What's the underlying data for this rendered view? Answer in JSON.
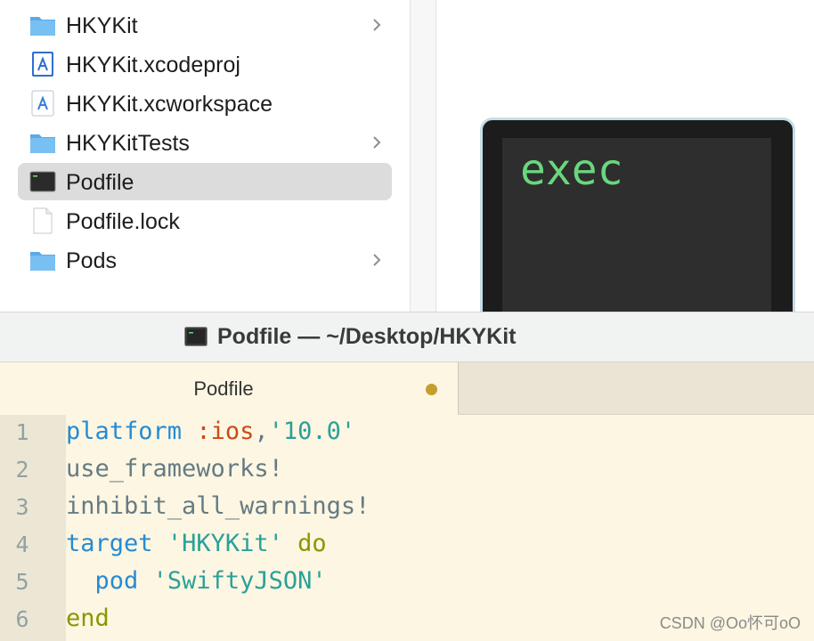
{
  "finder": {
    "files": [
      {
        "name": "HKYKit",
        "icon": "folder-icon",
        "has_children": true,
        "selected": false
      },
      {
        "name": "HKYKit.xcodeproj",
        "icon": "xcodeproj-icon",
        "has_children": false,
        "selected": false
      },
      {
        "name": "HKYKit.xcworkspace",
        "icon": "xcworkspace-icon",
        "has_children": false,
        "selected": false
      },
      {
        "name": "HKYKitTests",
        "icon": "folder-icon",
        "has_children": true,
        "selected": false
      },
      {
        "name": "Podfile",
        "icon": "terminal-file-icon",
        "has_children": false,
        "selected": true
      },
      {
        "name": "Podfile.lock",
        "icon": "document-icon",
        "has_children": false,
        "selected": false
      },
      {
        "name": "Pods",
        "icon": "folder-icon",
        "has_children": true,
        "selected": false
      }
    ],
    "preview": {
      "icon_text": "exec",
      "icon": "terminal-exec-icon"
    }
  },
  "editor": {
    "window_title": "Podfile — ~/Desktop/HKYKit",
    "tab_label": "Podfile",
    "unsaved": true,
    "code_lines": [
      {
        "num": "1",
        "tokens": [
          {
            "t": "platform",
            "c": "kw"
          },
          {
            "t": " ",
            "c": ""
          },
          {
            "t": ":ios",
            "c": "sym"
          },
          {
            "t": ",",
            "c": ""
          },
          {
            "t": "'10.0'",
            "c": "str"
          }
        ]
      },
      {
        "num": "2",
        "tokens": [
          {
            "t": "use_frameworks!",
            "c": ""
          }
        ]
      },
      {
        "num": "3",
        "tokens": [
          {
            "t": "inhibit_all_warnings!",
            "c": ""
          }
        ]
      },
      {
        "num": "4",
        "tokens": [
          {
            "t": "target",
            "c": "kw"
          },
          {
            "t": " ",
            "c": ""
          },
          {
            "t": "'HKYKit'",
            "c": "str"
          },
          {
            "t": " ",
            "c": ""
          },
          {
            "t": "do",
            "c": "kw2"
          }
        ]
      },
      {
        "num": "5",
        "tokens": [
          {
            "t": "  ",
            "c": ""
          },
          {
            "t": "pod",
            "c": "kw"
          },
          {
            "t": " ",
            "c": ""
          },
          {
            "t": "'SwiftyJSON'",
            "c": "str"
          }
        ]
      },
      {
        "num": "6",
        "tokens": [
          {
            "t": "end",
            "c": "kw2"
          }
        ]
      }
    ]
  },
  "watermark": "CSDN @Oo怀可oO",
  "colors": {
    "selection": "#dcdcdc",
    "editor_bg": "#fdf6e3",
    "keyword": "#268bd2",
    "symbol": "#cb4b16",
    "string": "#2aa198",
    "keyword_green": "#859900",
    "terminal_text": "#6ad77d"
  }
}
